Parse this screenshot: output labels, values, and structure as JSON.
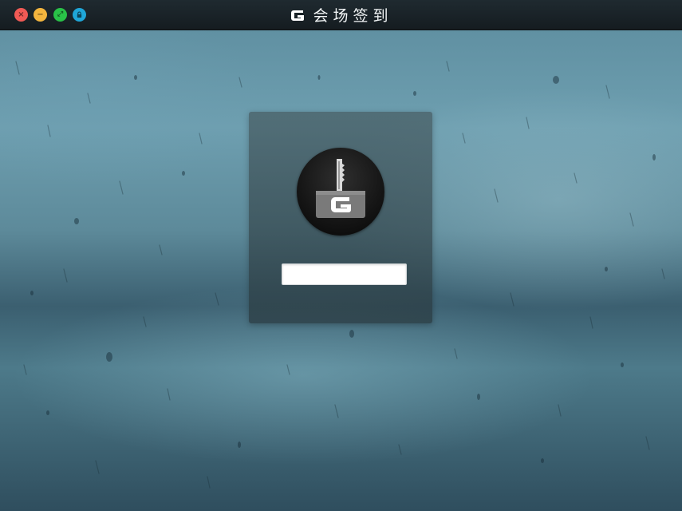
{
  "window": {
    "title": "会场签到",
    "buttons": [
      {
        "name": "close",
        "glyph": "×",
        "color": "#f05a55"
      },
      {
        "name": "minimize",
        "glyph": "−",
        "color": "#f3b53e"
      },
      {
        "name": "fullscreen",
        "glyph": "⤢",
        "color": "#29c248"
      },
      {
        "name": "lock",
        "glyph": "🔒",
        "color": "#1fa6d8"
      }
    ]
  },
  "logo": {
    "letter": "G",
    "icon": "key-icon"
  },
  "login": {
    "password_value": "",
    "password_placeholder": ""
  }
}
